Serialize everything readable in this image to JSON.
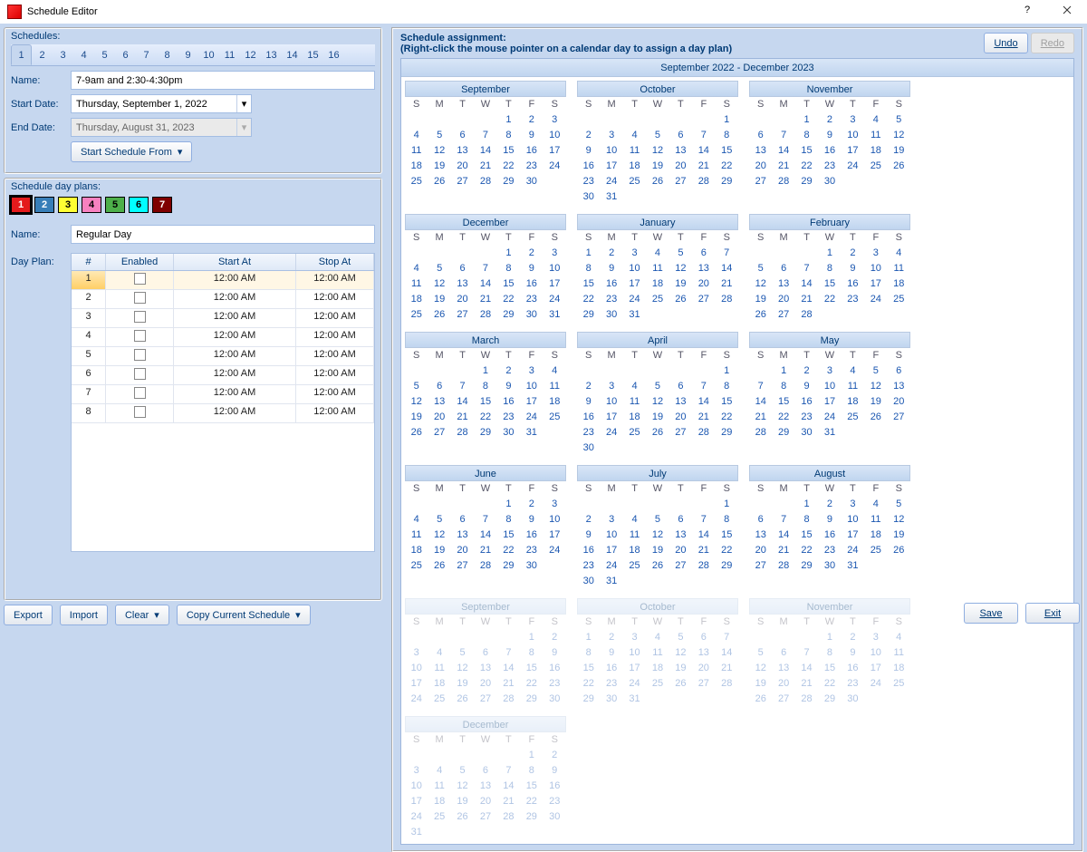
{
  "window": {
    "title": "Schedule Editor"
  },
  "schedules": {
    "label": "Schedules:",
    "tabs": [
      "1",
      "2",
      "3",
      "4",
      "5",
      "6",
      "7",
      "8",
      "9",
      "10",
      "11",
      "12",
      "13",
      "14",
      "15",
      "16"
    ],
    "active_tab_index": 0,
    "name_label": "Name:",
    "name_value": "7-9am and 2:30-4:30pm",
    "start_label": "Start Date:",
    "start_value": "Thursday, September 1, 2022",
    "end_label": "End Date:",
    "end_value": "Thursday, August 31, 2023",
    "start_from_btn": "Start Schedule From"
  },
  "dayplans": {
    "label": "Schedule day plans:",
    "swatches": [
      {
        "n": "1",
        "bg": "#e41a1c",
        "fg": "#fff",
        "sel": true
      },
      {
        "n": "2",
        "bg": "#377eb8",
        "fg": "#fff"
      },
      {
        "n": "3",
        "bg": "#ffff33",
        "fg": "#000"
      },
      {
        "n": "4",
        "bg": "#f781bf",
        "fg": "#000"
      },
      {
        "n": "5",
        "bg": "#4daf4a",
        "fg": "#000"
      },
      {
        "n": "6",
        "bg": "#00ffff",
        "fg": "#000"
      },
      {
        "n": "7",
        "bg": "#7f0000",
        "fg": "#fff"
      }
    ],
    "name_label": "Name:",
    "name_value": "Regular Day",
    "plan_label": "Day Plan:",
    "cols": {
      "num": "#",
      "en": "Enabled",
      "start": "Start At",
      "stop": "Stop At"
    },
    "rows": [
      {
        "n": "1",
        "start": "12:00 AM",
        "stop": "12:00 AM",
        "sel": true
      },
      {
        "n": "2",
        "start": "12:00 AM",
        "stop": "12:00 AM"
      },
      {
        "n": "3",
        "start": "12:00 AM",
        "stop": "12:00 AM"
      },
      {
        "n": "4",
        "start": "12:00 AM",
        "stop": "12:00 AM"
      },
      {
        "n": "5",
        "start": "12:00 AM",
        "stop": "12:00 AM"
      },
      {
        "n": "6",
        "start": "12:00 AM",
        "stop": "12:00 AM"
      },
      {
        "n": "7",
        "start": "12:00 AM",
        "stop": "12:00 AM"
      },
      {
        "n": "8",
        "start": "12:00 AM",
        "stop": "12:00 AM"
      }
    ]
  },
  "assign": {
    "title": "Schedule assignment:",
    "hint": "(Right-click the mouse pointer on a calendar day to assign a day plan)",
    "undo": "Undo",
    "redo": "Redo",
    "range_banner": "September 2022 - December 2023",
    "dow": [
      "S",
      "M",
      "T",
      "W",
      "T",
      "F",
      "S"
    ],
    "months": [
      {
        "name": "September",
        "first_dow": 4,
        "ndays": 30
      },
      {
        "name": "October",
        "first_dow": 6,
        "ndays": 31
      },
      {
        "name": "November",
        "first_dow": 2,
        "ndays": 30
      },
      {
        "name": "December",
        "first_dow": 4,
        "ndays": 31
      },
      {
        "name": "January",
        "first_dow": 0,
        "ndays": 31
      },
      {
        "name": "February",
        "first_dow": 3,
        "ndays": 28
      },
      {
        "name": "March",
        "first_dow": 3,
        "ndays": 31
      },
      {
        "name": "April",
        "first_dow": 6,
        "ndays": 30
      },
      {
        "name": "May",
        "first_dow": 1,
        "ndays": 31
      },
      {
        "name": "June",
        "first_dow": 4,
        "ndays": 30
      },
      {
        "name": "July",
        "first_dow": 6,
        "ndays": 31
      },
      {
        "name": "August",
        "first_dow": 2,
        "ndays": 31
      },
      {
        "name": "September",
        "first_dow": 5,
        "ndays": 30,
        "ghost": true
      },
      {
        "name": "October",
        "first_dow": 0,
        "ndays": 31,
        "ghost": true
      },
      {
        "name": "November",
        "first_dow": 3,
        "ndays": 30,
        "ghost": true
      },
      {
        "name": "December",
        "first_dow": 5,
        "ndays": 31,
        "ghost": true
      }
    ]
  },
  "footer": {
    "export": "Export",
    "import": "Import",
    "clear": "Clear",
    "copy": "Copy Current Schedule",
    "save": "Save",
    "exit": "Exit"
  }
}
